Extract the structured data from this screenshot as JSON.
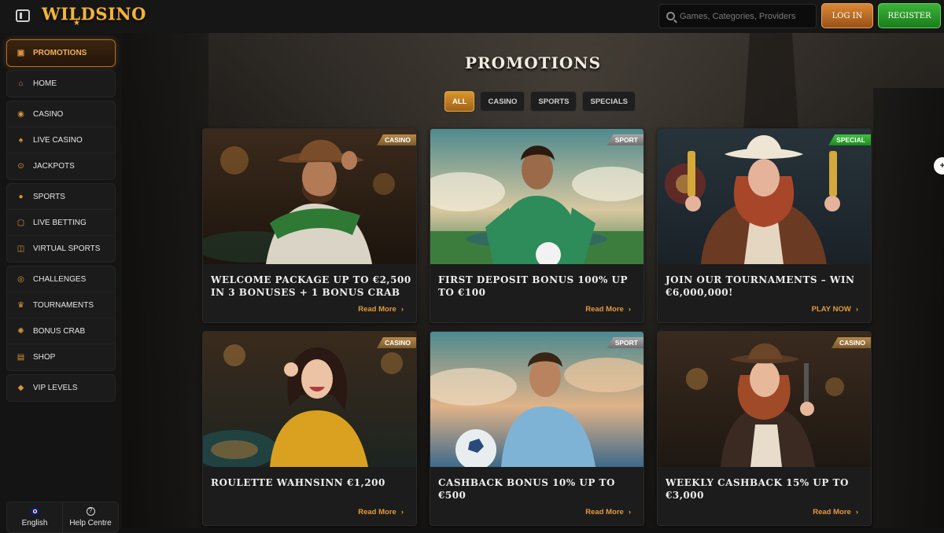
{
  "header": {
    "logo": "WILDSINO",
    "search_placeholder": "Games, Categories, Providers",
    "login_label": "LOG IN",
    "register_label": "REGISTER"
  },
  "sidebar": {
    "promotions": "PROMOTIONS",
    "home": "HOME",
    "casino": "CASINO",
    "live_casino": "LIVE CASINO",
    "jackpots": "JACKPOTS",
    "sports": "SPORTS",
    "live_betting": "LIVE BETTING",
    "virtual_sports": "VIRTUAL SPORTS",
    "challenges": "CHALLENGES",
    "tournaments": "TOURNAMENTS",
    "bonus_crab": "BONUS CRAB",
    "shop": "SHOP",
    "vip_levels": "VIP LEVELS",
    "language": "English",
    "help": "Help Centre"
  },
  "main": {
    "title": "PROMOTIONS",
    "filters": [
      "ALL",
      "CASINO",
      "SPORTS",
      "SPECIALS"
    ],
    "active_filter": "ALL",
    "cards": [
      {
        "tag": "CASINO",
        "title": "WELCOME PACKAGE UP TO €2,500 IN 3 BONUSES + 1 BONUS CRAB",
        "link": "Read More"
      },
      {
        "tag": "SPORT",
        "title": "FIRST DEPOSIT BONUS 100% UP TO €100",
        "link": "Read More"
      },
      {
        "tag": "SPECIAL",
        "title": "JOIN OUR TOURNAMENTS – WIN €6,000,000!",
        "link": "PLAY NOW"
      },
      {
        "tag": "CASINO",
        "title": "ROULETTE WAHNSINN €1,200",
        "link": "Read More"
      },
      {
        "tag": "SPORT",
        "title": "CASHBACK BONUS 10% UP TO €500",
        "link": "Read More"
      },
      {
        "tag": "CASINO",
        "title": "WEEKLY CASHBACK 15% UP TO €3,000",
        "link": "Read More"
      }
    ]
  },
  "colors": {
    "accent_orange": "#e39a3a",
    "register_green": "#2ea32c",
    "background": "#121212"
  }
}
